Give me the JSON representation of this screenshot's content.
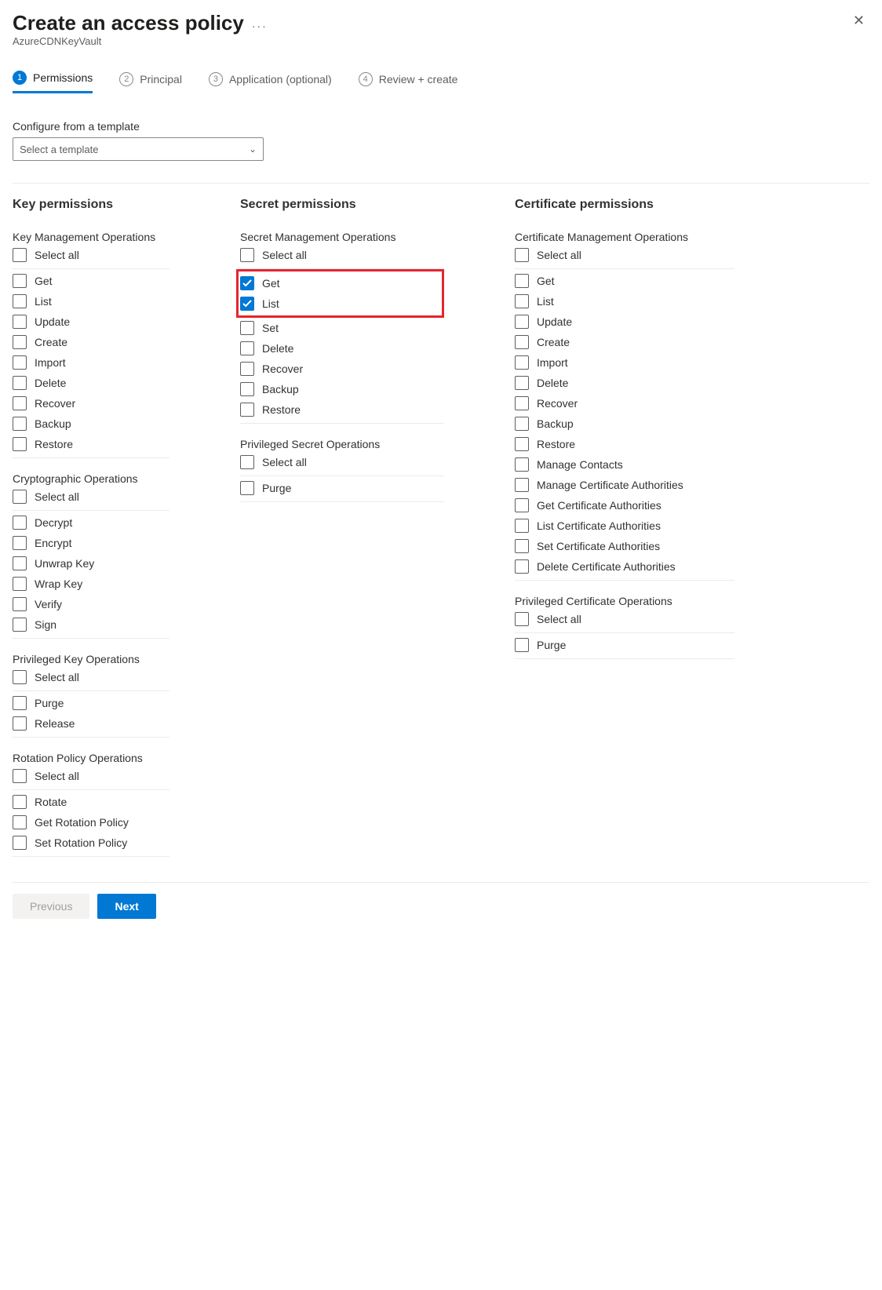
{
  "header": {
    "title": "Create an access policy",
    "subtitle": "AzureCDNKeyVault"
  },
  "stepper": [
    {
      "num": "1",
      "label": "Permissions",
      "active": true
    },
    {
      "num": "2",
      "label": "Principal",
      "active": false
    },
    {
      "num": "3",
      "label": "Application (optional)",
      "active": false
    },
    {
      "num": "4",
      "label": "Review + create",
      "active": false
    }
  ],
  "template": {
    "label": "Configure from a template",
    "placeholder": "Select a template"
  },
  "columns": {
    "key": {
      "title": "Key permissions",
      "groups": [
        {
          "title": "Key Management Operations",
          "select_all": "Select all",
          "items": [
            "Get",
            "List",
            "Update",
            "Create",
            "Import",
            "Delete",
            "Recover",
            "Backup",
            "Restore"
          ]
        },
        {
          "title": "Cryptographic Operations",
          "select_all": "Select all",
          "items": [
            "Decrypt",
            "Encrypt",
            "Unwrap Key",
            "Wrap Key",
            "Verify",
            "Sign"
          ]
        },
        {
          "title": "Privileged Key Operations",
          "select_all": "Select all",
          "items": [
            "Purge",
            "Release"
          ]
        },
        {
          "title": "Rotation Policy Operations",
          "select_all": "Select all",
          "items": [
            "Rotate",
            "Get Rotation Policy",
            "Set Rotation Policy"
          ]
        }
      ]
    },
    "secret": {
      "title": "Secret permissions",
      "groups": [
        {
          "title": "Secret Management Operations",
          "select_all": "Select all",
          "items": [
            "Get",
            "List",
            "Set",
            "Delete",
            "Recover",
            "Backup",
            "Restore"
          ],
          "checked": [
            "Get",
            "List"
          ],
          "highlight": [
            "Get",
            "List"
          ]
        },
        {
          "title": "Privileged Secret Operations",
          "select_all": "Select all",
          "items": [
            "Purge"
          ]
        }
      ]
    },
    "cert": {
      "title": "Certificate permissions",
      "groups": [
        {
          "title": "Certificate Management Operations",
          "select_all": "Select all",
          "items": [
            "Get",
            "List",
            "Update",
            "Create",
            "Import",
            "Delete",
            "Recover",
            "Backup",
            "Restore",
            "Manage Contacts",
            "Manage Certificate Authorities",
            "Get Certificate Authorities",
            "List Certificate Authorities",
            "Set Certificate Authorities",
            "Delete Certificate Authorities"
          ]
        },
        {
          "title": "Privileged Certificate Operations",
          "select_all": "Select all",
          "items": [
            "Purge"
          ]
        }
      ]
    }
  },
  "footer": {
    "previous": "Previous",
    "next": "Next"
  }
}
